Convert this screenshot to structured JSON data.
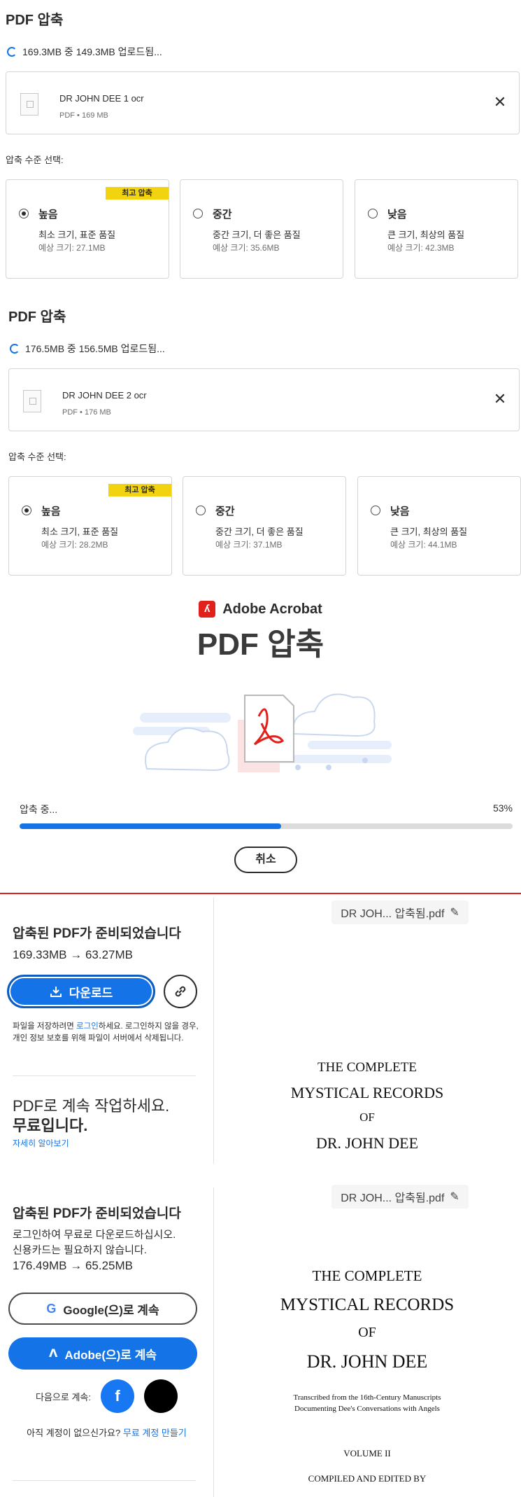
{
  "panels": [
    {
      "title": "PDF 압축",
      "upload_status": "169.3MB 중 149.3MB 업로드됨...",
      "file_name": "DR JOHN DEE 1 ocr",
      "file_meta": "PDF • 169 MB",
      "level_label": "압축 수준 선택:",
      "options": [
        {
          "name": "높음",
          "desc": "최소 크기, 표준 품질",
          "size": "예상 크기: 27.1MB",
          "badge": "최고 압축",
          "selected": true
        },
        {
          "name": "중간",
          "desc": "중간 크기, 더 좋은 품질",
          "size": "예상 크기: 35.6MB",
          "selected": false
        },
        {
          "name": "낮음",
          "desc": "큰 크기, 최상의 품질",
          "size": "예상 크기: 42.3MB",
          "selected": false
        }
      ]
    },
    {
      "title": "PDF 압축",
      "upload_status": "176.5MB 중 156.5MB 업로드됨...",
      "file_name": "DR JOHN DEE 2 ocr",
      "file_meta": "PDF • 176 MB",
      "level_label": "압축 수준 선택:",
      "options": [
        {
          "name": "높음",
          "desc": "최소 크기, 표준 품질",
          "size": "예상 크기: 28.2MB",
          "badge": "최고 압축",
          "selected": true
        },
        {
          "name": "중간",
          "desc": "중간 크기, 더 좋은 품질",
          "size": "예상 크기: 37.1MB",
          "selected": false
        },
        {
          "name": "낮음",
          "desc": "큰 크기, 최상의 품질",
          "size": "예상 크기: 44.1MB",
          "selected": false
        }
      ]
    }
  ],
  "progress": {
    "brand": "Adobe Acrobat",
    "title": "PDF 압축",
    "label": "압축 중...",
    "percent_text": "53%",
    "percent": 53,
    "cancel": "취소"
  },
  "ready1": {
    "title": "압축된 PDF가 준비되었습니다",
    "sizes": "169.33MB → 63.27MB",
    "download": "다운로드",
    "note_pre": "파일을 저장하려면 ",
    "note_link": "로그인",
    "note_post": "하세요. 로그인하지 않을 경우, 개인 정보 보호를 위해 파일이 서버에서 삭제됩니다.",
    "cont_line": "PDF로 계속 작업하세요.",
    "cont_free": "무료입니다.",
    "learn_more": "자세히 알아보기",
    "file_pill": "DR JOH... 압축됨.pdf",
    "doc": {
      "l1": "THE COMPLETE",
      "l2": "MYSTICAL RECORDS",
      "l3": "OF",
      "l4": "DR. JOHN DEE"
    }
  },
  "ready2": {
    "title": "압축된 PDF가 준비되었습니다",
    "login_line1": "로그인하여 무료로 다운로드하십시오.",
    "login_line2": "신용카드는 필요하지 않습니다.",
    "sizes": "176.49MB → 65.25MB",
    "google": "Google(으)로 계속",
    "adobe": "Adobe(으)로 계속",
    "continue_with": "다음으로 계속:",
    "no_account": "아직 계정이 없으신가요?",
    "create_account": "무료 계정 만들기",
    "file_pill": "DR JOH... 압축됨.pdf",
    "doc": {
      "l1": "THE COMPLETE",
      "l2": "MYSTICAL RECORDS",
      "l3": "OF",
      "l4": "DR. JOHN DEE",
      "sub1": "Transcribed from the 16th-Century Manuscripts",
      "sub2": "Documenting Dee's Conversations with Angels",
      "vol": "VOLUME II",
      "compiled": "COMPILED AND EDITED BY"
    }
  },
  "colors": {
    "accent": "#1473e6",
    "badge": "#f2d30f",
    "adobe_red": "#e0211c",
    "facebook": "#1877f2"
  }
}
